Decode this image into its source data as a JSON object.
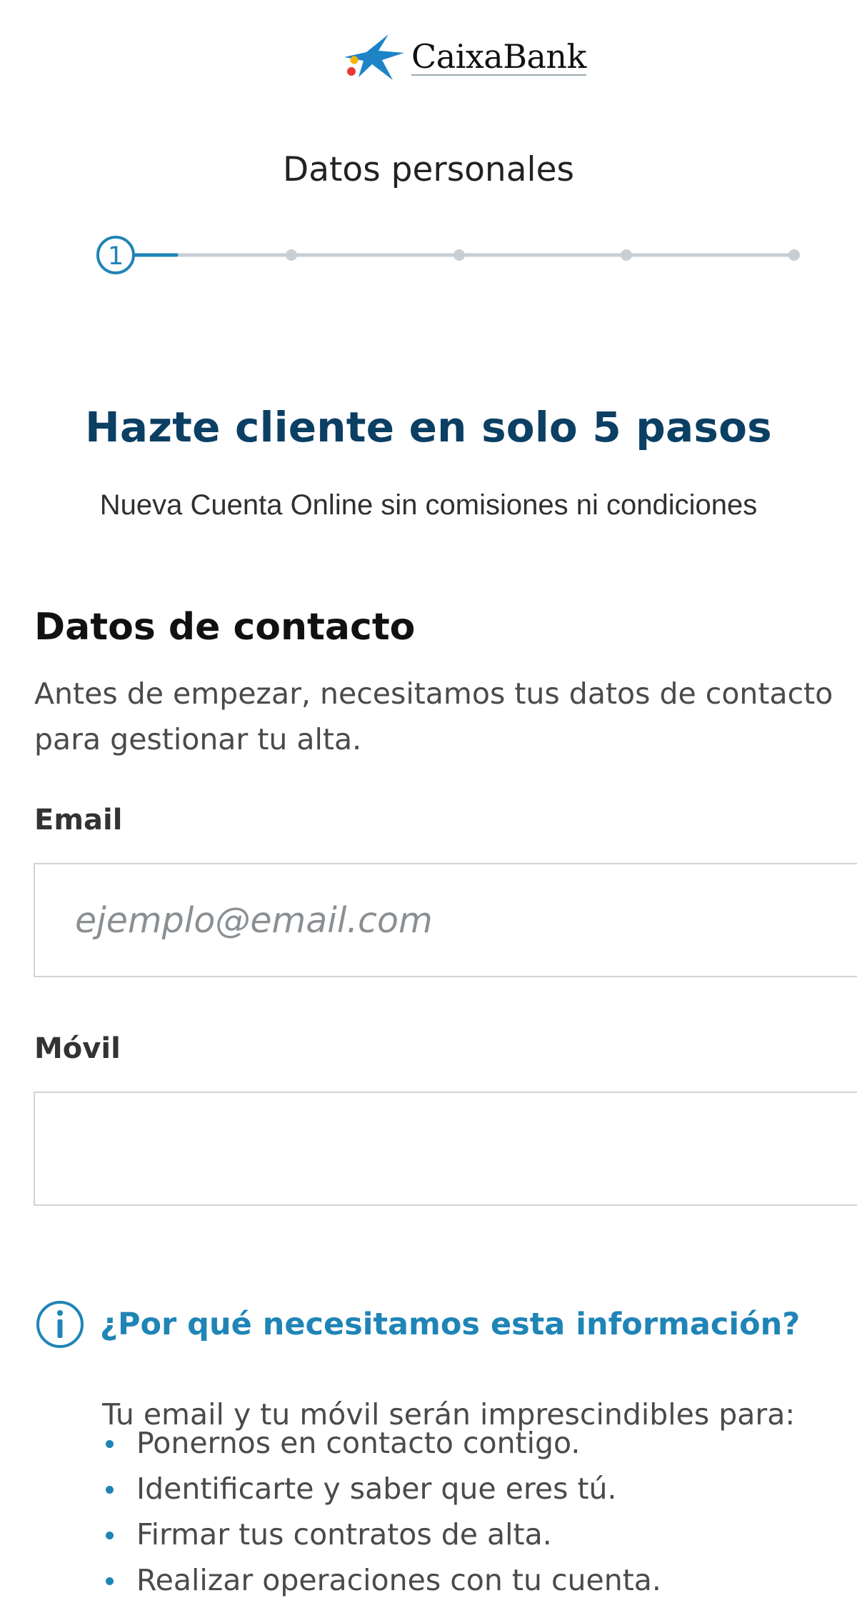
{
  "brand": {
    "name": "CaixaBank",
    "colors": {
      "primary_navy": "#0b3f63",
      "link_blue": "#1f84b6",
      "progress_track": "#c7ced4"
    }
  },
  "progress": {
    "title": "Datos personales",
    "current_step": "1",
    "total_steps": 5
  },
  "hero": {
    "title": "Hazte cliente en solo 5 pasos",
    "subtitle": "Nueva Cuenta Online sin comisiones ni condiciones"
  },
  "contact": {
    "title": "Datos de contacto",
    "description": "Antes de empezar, necesitamos tus datos de contacto para gestionar tu alta."
  },
  "form": {
    "email": {
      "label": "Email",
      "placeholder": "ejemplo@email.com",
      "value": ""
    },
    "mobile": {
      "label": "Móvil",
      "placeholder": "",
      "value": ""
    }
  },
  "info": {
    "icon": "info-icon",
    "link": "¿Por qué necesitamos esta información?",
    "intro": "Tu email y tu móvil serán imprescindibles para:",
    "items": [
      "Ponernos en contacto contigo.",
      "Identificarte y saber que eres tú.",
      "Firmar tus contratos de alta.",
      "Realizar operaciones con tu cuenta."
    ]
  }
}
